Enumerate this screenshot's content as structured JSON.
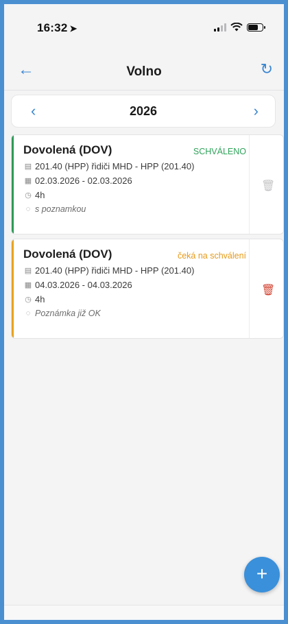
{
  "status_bar": {
    "time": "16:32",
    "location_icon": "➤"
  },
  "header": {
    "title": "Volno",
    "back_icon": "←",
    "refresh_icon": "↻"
  },
  "year_selector": {
    "year": "2026",
    "prev_icon": "‹",
    "next_icon": "›"
  },
  "cards": [
    {
      "title": "Dovolená (DOV)",
      "status": "SCHVÁLENO",
      "status_color": "#2fa35a",
      "stripe_color": "#2e9a55",
      "position": "201.40 (HPP) řidiči MHD - HPP (201.40)",
      "dates": "02.03.2026 - 02.03.2026",
      "hours": "4h",
      "note": "s poznamkou",
      "trash_color": "#c4c4c6"
    },
    {
      "title": "Dovolená (DOV)",
      "status": "čeká na schválení",
      "status_color": "#e69a18",
      "stripe_color": "#e8a21f",
      "position": "201.40 (HPP) řidiči MHD - HPP (201.40)",
      "dates": "04.03.2026 - 04.03.2026",
      "hours": "4h",
      "note": "Poznámka již OK",
      "trash_color": "#d2402e"
    }
  ],
  "fab": {
    "icon": "+"
  },
  "icons": {
    "building": "▤",
    "calendar": "▦",
    "clock": "◷",
    "comment": "◌",
    "trash": "🗑"
  }
}
